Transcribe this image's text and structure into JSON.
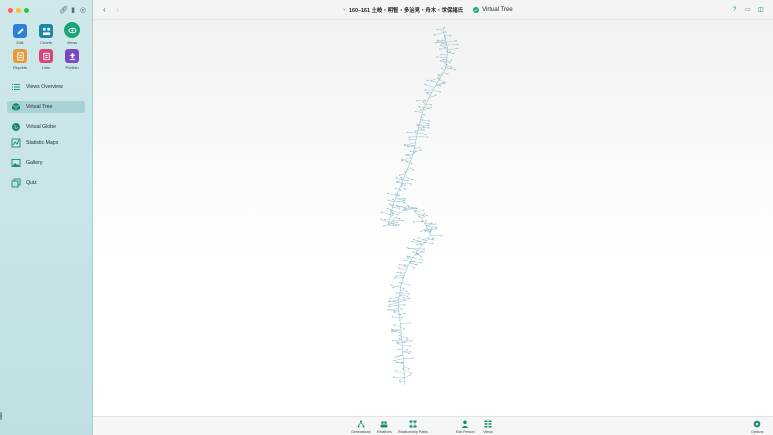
{
  "sidebar": {
    "tools": [
      {
        "label": "Edit",
        "icon": "pencil-icon",
        "color": "#2d7fd6"
      },
      {
        "label": "Charts",
        "icon": "chart-icon",
        "color": "#1a86a8"
      },
      {
        "label": "Views",
        "icon": "eye-icon",
        "color": "#1aa579"
      },
      {
        "label": "Reports",
        "icon": "report-icon",
        "color": "#e49a3a"
      },
      {
        "label": "Lists",
        "icon": "list-icon",
        "color": "#d6457c"
      },
      {
        "label": "Publish",
        "icon": "publish-icon",
        "color": "#7b47c2"
      }
    ],
    "items": [
      {
        "label": "Views Overview",
        "icon": "list-lines-icon"
      },
      {
        "label": "Virtual Tree",
        "icon": "cube-icon",
        "active": true
      },
      {
        "label": "Virtual Globe",
        "icon": "globe-icon"
      },
      {
        "label": "Statistic Maps",
        "icon": "map-chart-icon"
      },
      {
        "label": "Gallery",
        "icon": "image-icon"
      },
      {
        "label": "Quiz",
        "icon": "quiz-cards-icon"
      }
    ]
  },
  "titlebar": {
    "family_title": "160–161 土岐・明智・多治見・舟木・世保諸氏",
    "view_title": "Virtual Tree"
  },
  "bottombar": {
    "buttons": [
      {
        "label": "Generations",
        "icon": "generations-icon"
      },
      {
        "label": "Relatives",
        "icon": "relatives-icon"
      },
      {
        "label": "Relationship Paths",
        "icon": "relationship-paths-icon"
      },
      {
        "label": "Edit Person",
        "icon": "edit-person-icon"
      },
      {
        "label": "Views",
        "icon": "views-grid-icon"
      }
    ],
    "options_label": "Options"
  },
  "colors": {
    "accent": "#0f8a6a",
    "tree_nodes": "#8fb9c4",
    "sidebar_bg": "#c6e4e7"
  }
}
